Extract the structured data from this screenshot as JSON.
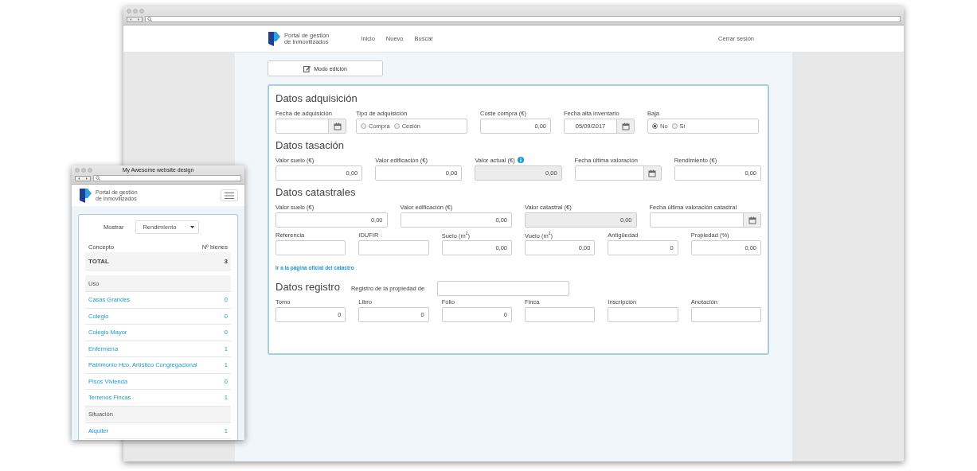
{
  "desktop_window": {
    "header": {
      "logo_text": [
        "Portal de gestión",
        "de inmovilizados"
      ],
      "nav": [
        "Inicio",
        "Nuevo",
        "Buscar"
      ],
      "logout": "Cerrar sesión"
    },
    "edit_button": "Modo edición",
    "sections": [
      {
        "title": "Datos adquisición",
        "lines": [
          {
            "fields": [
              {
                "kind": "date",
                "label": "Fecha de adquisición"
              },
              {
                "kind": "radio",
                "label": "Tipo de adquisición",
                "options": [
                  {
                    "label": "Compra",
                    "selected": false
                  },
                  {
                    "label": "Cesión",
                    "selected": false
                  }
                ]
              },
              {
                "kind": "number",
                "label": "Coste compra (€)",
                "value": "0,00"
              },
              {
                "kind": "date",
                "label": "Fecha alta inventario",
                "value": "05/09/2017"
              },
              {
                "kind": "radio",
                "label": "Baja",
                "options": [
                  {
                    "label": "No",
                    "selected": true
                  },
                  {
                    "label": "Sí",
                    "selected": false
                  }
                ]
              }
            ]
          }
        ]
      },
      {
        "title": "Datos tasación",
        "lines": [
          {
            "fields": [
              {
                "kind": "number",
                "label": "Valor suelo (€)",
                "value": "0,00"
              },
              {
                "kind": "number",
                "label": "Valor edificación (€)",
                "value": "0,00"
              },
              {
                "kind": "readonly",
                "label": "Valor actual (€)",
                "value": "0,00",
                "info": true
              },
              {
                "kind": "date",
                "label": "Fecha última valoración"
              },
              {
                "kind": "number",
                "label": "Rendimiento (€)",
                "value": "0,00"
              }
            ]
          }
        ]
      },
      {
        "title": "Datos catastrales",
        "lines": [
          {
            "fields": [
              {
                "kind": "number",
                "label": "Valor suelo (€)",
                "value": "0,00"
              },
              {
                "kind": "number",
                "label": "Valor edificación (€)",
                "value": "0,00"
              },
              {
                "kind": "readonly",
                "label": "Valor catastral (€)",
                "value": "0,00"
              },
              {
                "kind": "date",
                "label": "Fecha última valoración catastral"
              }
            ]
          },
          {
            "fields": [
              {
                "kind": "text",
                "label": "Referencia"
              },
              {
                "kind": "text",
                "label": "IDUFIR"
              },
              {
                "kind": "number",
                "label": "Suelo (m$^{2}$)",
                "value": "0,00"
              },
              {
                "kind": "number",
                "label": "Vuelo (m$^{2}$)",
                "value": "0,00"
              },
              {
                "kind": "number",
                "label": "Antigüedad",
                "value": "0"
              },
              {
                "kind": "number",
                "label": "Propiedad (%)",
                "value": "0,00"
              }
            ]
          }
        ],
        "link": "Ir a la página oficial del catastro"
      },
      {
        "title": "Datos registro",
        "inline_field": {
          "label": "Registro de la propiedad de"
        },
        "lines": [
          {
            "fields": [
              {
                "kind": "number",
                "label": "Tomo",
                "value": "0"
              },
              {
                "kind": "number",
                "label": "Libro",
                "value": "0"
              },
              {
                "kind": "number",
                "label": "Folio",
                "value": "0"
              },
              {
                "kind": "text",
                "label": "Finca"
              },
              {
                "kind": "text",
                "label": "Inscripción"
              },
              {
                "kind": "text",
                "label": "Anotación"
              }
            ]
          }
        ]
      }
    ]
  },
  "mobile_window": {
    "title": "My Awesome website design",
    "header": {
      "logo_text": [
        "Portal de gestión",
        "de inmovilizados"
      ]
    },
    "filter": {
      "label": "Mostrar",
      "value": "Rendimiento"
    },
    "columns": [
      "Concepto",
      "Nº bienes"
    ],
    "total": {
      "label": "TOTAL",
      "count": "3"
    },
    "groups": [
      {
        "title": "Uso",
        "items": [
          {
            "label": "Casas Grandes",
            "count": "0"
          },
          {
            "label": "Colegio",
            "count": "0"
          },
          {
            "label": "Colegio Mayor",
            "count": "0"
          },
          {
            "label": "Enfermería",
            "count": "1"
          },
          {
            "label": "Patrimonio Hco. Artístico Congregacional",
            "count": "1"
          },
          {
            "label": "Pisos Vivienda",
            "count": "0"
          },
          {
            "label": "Terrenos Fincas",
            "count": "1"
          }
        ]
      },
      {
        "title": "Situación",
        "items": [
          {
            "label": "Alquiler",
            "count": "1"
          }
        ]
      }
    ]
  }
}
